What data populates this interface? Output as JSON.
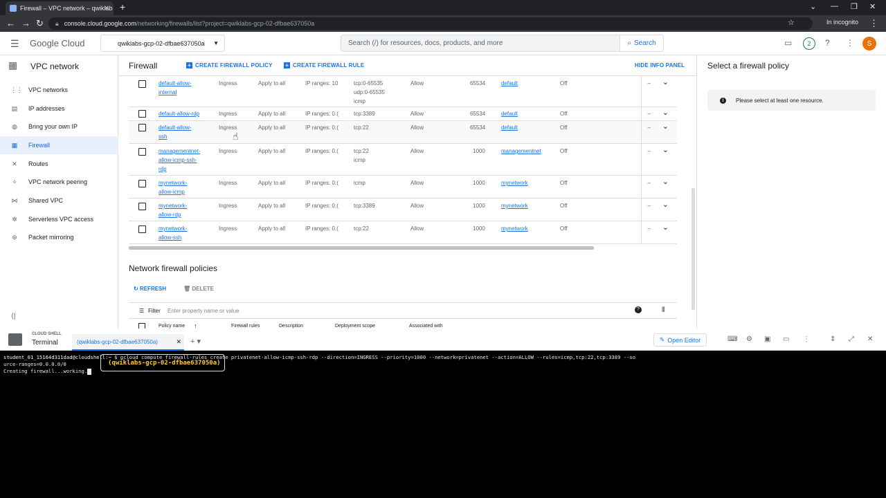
{
  "browser": {
    "tab_title": "Firewall – VPC network – qwiklab",
    "url_host": "console.cloud.google.com",
    "url_path": "/networking/firewalls/list?project=qwiklabs-gcp-02-dfbae637050a",
    "incognito_label": "In incognito"
  },
  "header": {
    "logo": "Google Cloud",
    "project": "qwiklabs-gcp-02-dfbae637050a",
    "search_placeholder": "Search (/) for resources, docs, products, and more",
    "search_button": "Search",
    "notif_count": "2",
    "avatar_letter": "S"
  },
  "sidebar": {
    "title": "VPC network",
    "items": [
      {
        "label": "VPC networks",
        "icon": "network-icon"
      },
      {
        "label": "IP addresses",
        "icon": "ip-icon"
      },
      {
        "label": "Bring your own IP",
        "icon": "globe-icon"
      },
      {
        "label": "Firewall",
        "icon": "firewall-icon",
        "active": true
      },
      {
        "label": "Routes",
        "icon": "routes-icon"
      },
      {
        "label": "VPC network peering",
        "icon": "peering-icon"
      },
      {
        "label": "Shared VPC",
        "icon": "shared-icon"
      },
      {
        "label": "Serverless VPC access",
        "icon": "serverless-icon"
      },
      {
        "label": "Packet mirroring",
        "icon": "mirror-icon"
      }
    ]
  },
  "toolbar": {
    "title": "Firewall",
    "create_policy": "CREATE FIREWALL POLICY",
    "create_rule": "CREATE FIREWALL RULE",
    "hide_panel": "HIDE INFO PANEL"
  },
  "rules": [
    {
      "name": [
        "default-allow-",
        "internal"
      ],
      "type": "Ingress",
      "targets": "Apply to all",
      "filters": "IP ranges: 10",
      "protocols": [
        "tcp:0-65535",
        "udp:0-65535",
        "icmp"
      ],
      "action": "Allow",
      "priority": "65534",
      "network": "default",
      "logs": "Off",
      "dash": "–"
    },
    {
      "name": [
        "default-allow-rdp"
      ],
      "type": "Ingress",
      "targets": "Apply to all",
      "filters": "IP ranges: 0.(",
      "protocols": [
        "tcp:3389"
      ],
      "action": "Allow",
      "priority": "65534",
      "network": "default",
      "logs": "Off",
      "dash": "–"
    },
    {
      "name": [
        "default-allow-",
        "ssh"
      ],
      "type": "Ingress",
      "targets": "Apply to all",
      "filters": "IP ranges: 0.(",
      "protocols": [
        "tcp:22"
      ],
      "action": "Allow",
      "priority": "65534",
      "network": "default",
      "logs": "Off",
      "dash": "–"
    },
    {
      "name": [
        "managementnet-",
        "allow-icmp-ssh-",
        "rdp"
      ],
      "type": "Ingress",
      "targets": "Apply to all",
      "filters": "IP ranges: 0.(",
      "protocols": [
        "tcp:22",
        "icmp"
      ],
      "action": "Allow",
      "priority": "1000",
      "network": "managementnet",
      "logs": "Off",
      "dash": "–"
    },
    {
      "name": [
        "mynetwork-",
        "allow-icmp"
      ],
      "type": "Ingress",
      "targets": "Apply to all",
      "filters": "IP ranges: 0.(",
      "protocols": [
        "icmp"
      ],
      "action": "Allow",
      "priority": "1000",
      "network": "mynetwork",
      "logs": "Off",
      "dash": "–"
    },
    {
      "name": [
        "mynetwork-",
        "allow-rdp"
      ],
      "type": "Ingress",
      "targets": "Apply to all",
      "filters": "IP ranges: 0.(",
      "protocols": [
        "tcp:3389"
      ],
      "action": "Allow",
      "priority": "1000",
      "network": "mynetwork",
      "logs": "Off",
      "dash": "–"
    },
    {
      "name": [
        "mynetwork-",
        "allow-ssh"
      ],
      "type": "Ingress",
      "targets": "Apply to all",
      "filters": "IP ranges: 0.(",
      "protocols": [
        "tcp:22"
      ],
      "action": "Allow",
      "priority": "1000",
      "network": "mynetwork",
      "logs": "Off",
      "dash": "–"
    }
  ],
  "policies": {
    "title": "Network firewall policies",
    "refresh": "REFRESH",
    "delete": "DELETE",
    "filter_label": "Filter",
    "filter_placeholder": "Enter property name or value",
    "columns": [
      "Policy name",
      "Firewall rules",
      "Description",
      "Deployment scope",
      "Associated with"
    ]
  },
  "info_panel": {
    "title": "Select a firewall policy",
    "message": "Please select at least one resource."
  },
  "cloudshell": {
    "label": "CLOUD SHELL",
    "terminal": "Terminal",
    "tab": "(qwiklabs-gcp-02-dfbae637050a)",
    "open_editor": "Open Editor",
    "prompt_user": "student_01_15164d311dad@cloudshell:~",
    "prompt_project": "(qwiklabs-gcp-02-dfbae637050a)",
    "command": "$ gcloud compute firewall-rules create privatenet-allow-icmp-ssh-rdp --direction=INGRESS --priority=1000 --network=privatenet --action=ALLOW --rules=icmp,tcp:22,tcp:3389 --so",
    "command_cont": "urce-ranges=0.0.0.0/0",
    "output": "Creating firewall...working."
  }
}
